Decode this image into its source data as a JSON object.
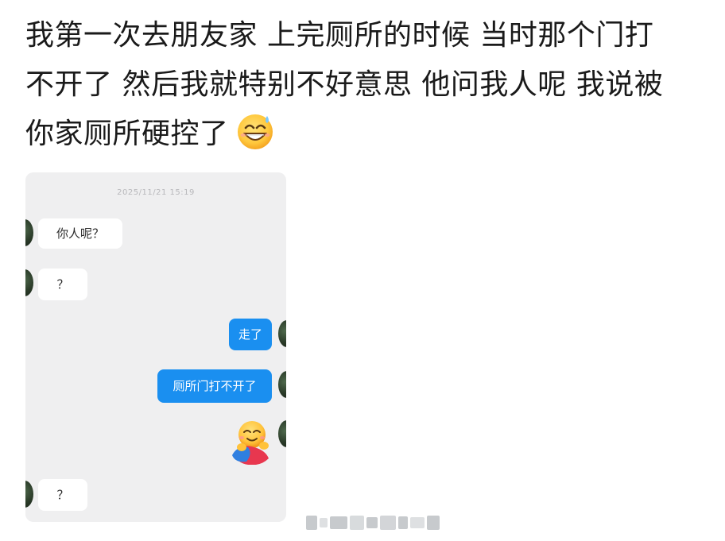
{
  "post": {
    "lines": [
      "我第一次去朋友家 上完厕所的时候 当时那个门打",
      "不开了 然后我就特别不好意思 他问我人呢 我说被",
      "你家厕所硬控了"
    ],
    "emoji": "grinning-sweat-emoji"
  },
  "chat": {
    "timestamp": "2025/11/21 15:19",
    "messages": [
      {
        "side": "in",
        "text": "你人呢？"
      },
      {
        "side": "in",
        "text": "？"
      },
      {
        "side": "out",
        "text": "走了"
      },
      {
        "side": "out",
        "text": "厕所门打不开了"
      },
      {
        "side": "out",
        "sticker": "hug-emoji-sticker"
      },
      {
        "side": "in",
        "text": "？"
      }
    ]
  },
  "colors": {
    "chat_background": "#efeff0",
    "outgoing_bubble": "#1a8ff0",
    "incoming_bubble": "#ffffff",
    "post_text": "#1a1a1a"
  }
}
